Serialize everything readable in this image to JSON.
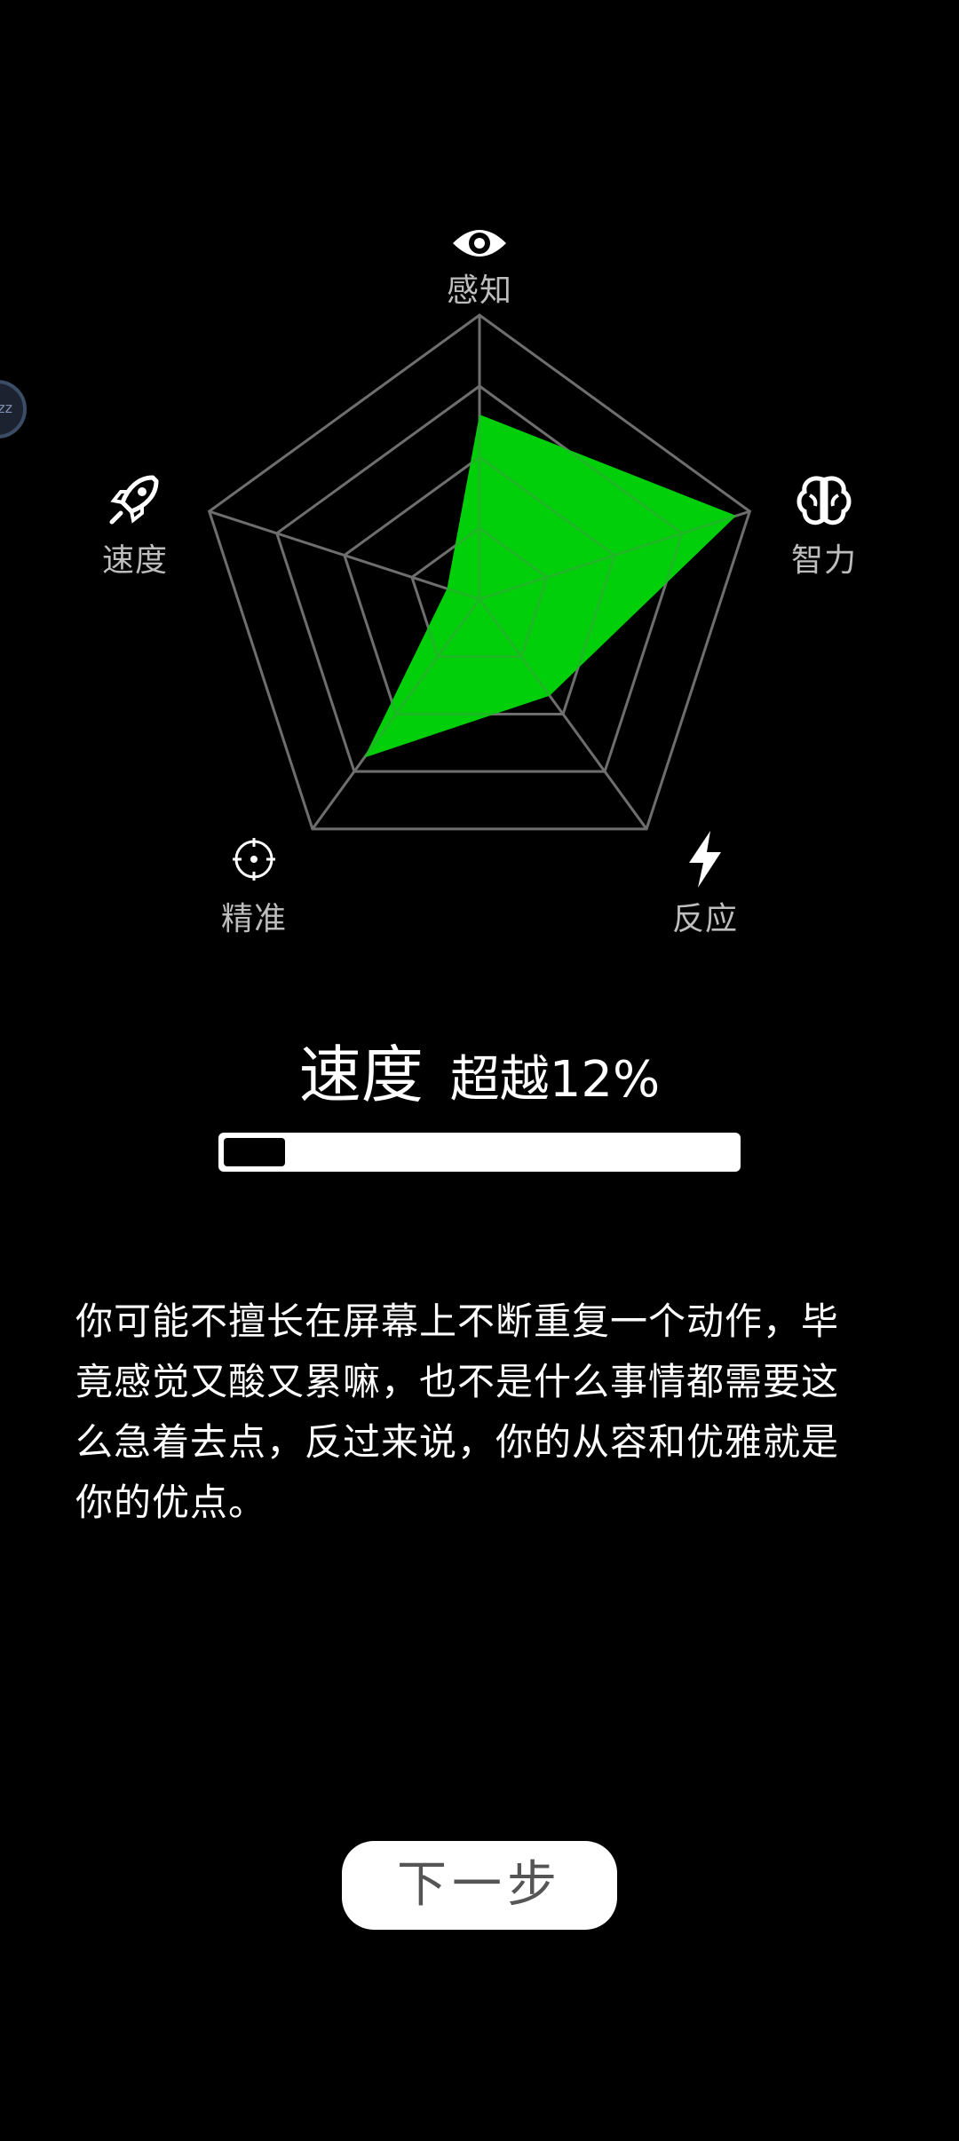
{
  "radar": {
    "axes": [
      {
        "label": "感知",
        "icon": "eye-icon",
        "value": 0.65
      },
      {
        "label": "智力",
        "icon": "brain-icon",
        "value": 0.95
      },
      {
        "label": "反应",
        "icon": "lightning-icon",
        "value": 0.42
      },
      {
        "label": "精准",
        "icon": "crosshair-icon",
        "value": 0.69
      },
      {
        "label": "速度",
        "icon": "rocket-icon",
        "value": 0.12
      }
    ],
    "levels": 4,
    "fill_color": "#00d60a",
    "grid_color": "#6e6e6e"
  },
  "result": {
    "title": "速度",
    "percent_text": "超越12%",
    "progress": 0.12
  },
  "description": "你可能不擅长在屏幕上不断重复一个动作，毕竟感觉又酸又累嘛，也不是什么事情都需要这么急着去点，反过来说，你的从容和优雅就是你的优点。",
  "float_bubble_text": "zz",
  "next_button_label": "下一步"
}
